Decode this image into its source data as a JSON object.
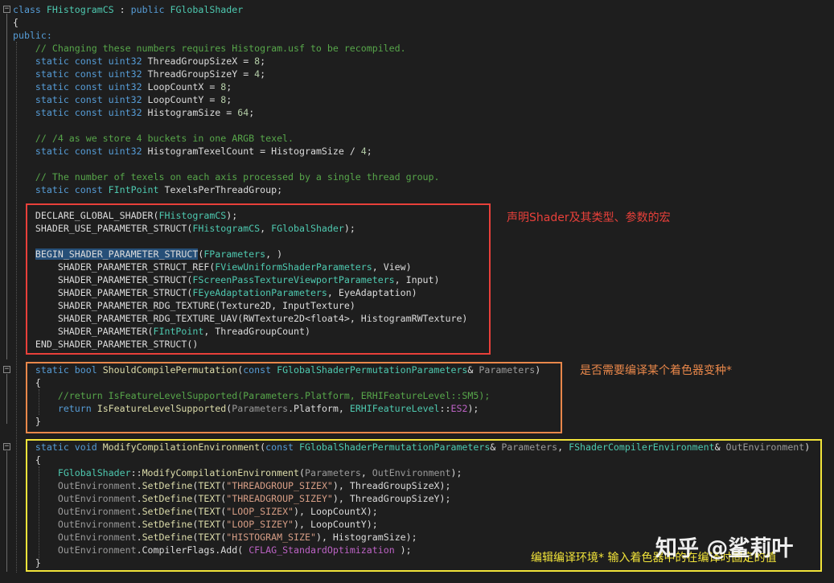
{
  "colors": {
    "background": "#1e1e1e",
    "keyword": "#569cd6",
    "type": "#4ec9b0",
    "comment": "#57a64a",
    "string": "#d69d85",
    "box_red": "#e8403a",
    "box_orange": "#e8874a",
    "box_yellow": "#f2e43a"
  },
  "code": {
    "l1_class": "class",
    "l1_name": "FHistogramCS",
    "l1_colon": " : ",
    "l1_public": "public",
    "l1_base": "FGlobalShader",
    "l2": "{",
    "l3": "public:",
    "l4": "// Changing these numbers requires Histogram.usf to be recompiled.",
    "l5": [
      "static const",
      "uint32",
      "ThreadGroupSizeX = ",
      "8",
      ";"
    ],
    "l6": [
      "static const",
      "uint32",
      "ThreadGroupSizeY = ",
      "4",
      ";"
    ],
    "l7": [
      "static const",
      "uint32",
      "LoopCountX = ",
      "8",
      ";"
    ],
    "l8": [
      "static const",
      "uint32",
      "LoopCountY = ",
      "8",
      ";"
    ],
    "l9": [
      "static const",
      "uint32",
      "HistogramSize = ",
      "64",
      ";"
    ],
    "l11": "// /4 as we store 4 buckets in one ARGB texel.",
    "l12": [
      "static const",
      "uint32",
      "HistogramTexelCount = HistogramSize / ",
      "4",
      ";"
    ],
    "l14": "// The number of texels on each axis processed by a single thread group.",
    "l15": [
      "static const",
      "FIntPoint",
      "TexelsPerThreadGroup;"
    ],
    "l17": [
      "DECLARE_GLOBAL_SHADER",
      "(",
      "FHistogramCS",
      ");"
    ],
    "l18": [
      "SHADER_USE_PARAMETER_STRUCT",
      "(",
      "FHistogramCS",
      ", ",
      "FGlobalShader",
      ");"
    ],
    "l20": [
      "BEGIN_SHADER_PARAMETER_STRUCT",
      "(",
      "FParameters",
      ", )"
    ],
    "l21": [
      "SHADER_PARAMETER_STRUCT_REF",
      "(",
      "FViewUniformShaderParameters",
      ", View)"
    ],
    "l22": [
      "SHADER_PARAMETER_STRUCT",
      "(",
      "FScreenPassTextureViewportParameters",
      ", Input)"
    ],
    "l23": [
      "SHADER_PARAMETER_STRUCT",
      "(",
      "FEyeAdaptationParameters",
      ", EyeAdaptation)"
    ],
    "l24": [
      "SHADER_PARAMETER_RDG_TEXTURE",
      "(Texture2D, InputTexture)"
    ],
    "l25": [
      "SHADER_PARAMETER_RDG_TEXTURE_UAV",
      "(RWTexture2D<float4>, HistogramRWTexture)"
    ],
    "l26": [
      "SHADER_PARAMETER",
      "(",
      "FIntPoint",
      ", ThreadGroupCount)"
    ],
    "l27": [
      "END_SHADER_PARAMETER_STRUCT",
      "()"
    ],
    "l28": [
      "static bool",
      "ShouldCompilePermutation",
      "(",
      "const",
      "FGlobalShaderPermutationParameters",
      "& ",
      "Parameters",
      ")"
    ],
    "l29": "{",
    "l30": "//return IsFeatureLevelSupported(Parameters.Platform, ERHIFeatureLevel::SM5);",
    "l31": [
      "return",
      "IsFeatureLevelSupported",
      "(",
      "Parameters",
      ".Platform, ",
      "ERHIFeatureLevel",
      "::",
      "ES2",
      ");"
    ],
    "l32": "}",
    "l34": [
      "static void",
      "ModifyCompilationEnvironment",
      "(",
      "const",
      "FGlobalShaderPermutationParameters",
      "& ",
      "Parameters",
      ", ",
      "FShaderCompilerEnvironment",
      "& ",
      "OutEnvironment",
      ")"
    ],
    "l35": "{",
    "l36": [
      "FGlobalShader",
      "::",
      "ModifyCompilationEnvironment",
      "(",
      "Parameters",
      ", ",
      "OutEnvironment",
      ");"
    ],
    "l37": [
      "OutEnvironment",
      ".",
      "SetDefine",
      "(",
      "TEXT",
      "(",
      "\"THREADGROUP_SIZEX\"",
      "), ThreadGroupSizeX);"
    ],
    "l38": [
      "OutEnvironment",
      ".",
      "SetDefine",
      "(",
      "TEXT",
      "(",
      "\"THREADGROUP_SIZEY\"",
      "), ThreadGroupSizeY);"
    ],
    "l39": [
      "OutEnvironment",
      ".",
      "SetDefine",
      "(",
      "TEXT",
      "(",
      "\"LOOP_SIZEX\"",
      "), LoopCountX);"
    ],
    "l40": [
      "OutEnvironment",
      ".",
      "SetDefine",
      "(",
      "TEXT",
      "(",
      "\"LOOP_SIZEY\"",
      "), LoopCountY);"
    ],
    "l41": [
      "OutEnvironment",
      ".",
      "SetDefine",
      "(",
      "TEXT",
      "(",
      "\"HISTOGRAM_SIZE\"",
      "), HistogramSize);"
    ],
    "l42": [
      "OutEnvironment",
      ".CompilerFlags.Add( ",
      "CFLAG_StandardOptimization",
      " );"
    ],
    "l43": "}"
  },
  "annotations": {
    "red": "声明Shader及其类型、参数的宏",
    "orange": "是否需要编译某个着色器变种*",
    "yellow": "编辑编译环境* 输入着色器中的在编译时固定的值"
  },
  "watermark": "知乎 @鲨莉叶"
}
